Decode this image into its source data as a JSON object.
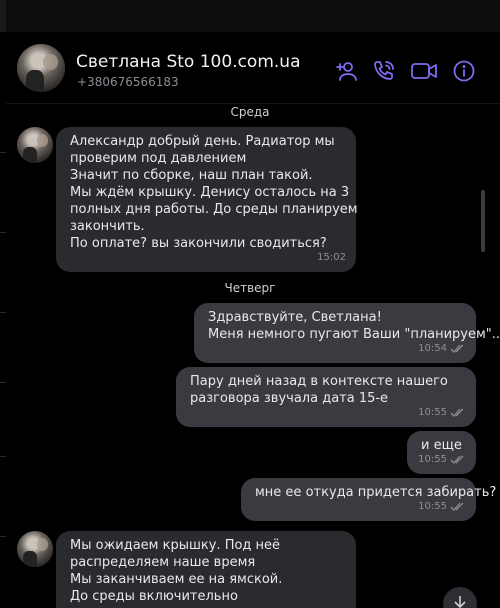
{
  "header": {
    "contact_name": "Светлана Sto 100.com.ua",
    "phone": "+380676566183",
    "icons": [
      "add-contact-icon",
      "phone-icon",
      "video-camera-icon",
      "info-icon"
    ],
    "accent_color": "#7f6bf0"
  },
  "days": {
    "wednesday": "Среда",
    "thursday": "Четверг"
  },
  "messages": [
    {
      "direction": "in",
      "lines": [
        "Александр добрый день. Радиатор мы",
        "проверим под давлением",
        "Значит по сборке, наш план такой.",
        "Мы ждём крышку.  Денису осталось на 3",
        "полных дня работы. До среды планируем",
        "закончить.",
        "По оплате? вы закончили сводиться?"
      ],
      "time": "15:02"
    },
    {
      "direction": "out",
      "lines": [
        "Здравствуйте, Светлана!",
        "Меня немного пугают Ваши \"планируем\".."
      ],
      "time": "10:54"
    },
    {
      "direction": "out",
      "lines": [
        "Пару дней назад в контексте нашего",
        "разговора звучала дата 15-е"
      ],
      "time": "10:55"
    },
    {
      "direction": "out",
      "lines": [
        "и еще"
      ],
      "time": "10:55"
    },
    {
      "direction": "out",
      "lines": [
        "мне ее откуда придется забирать?"
      ],
      "time": "10:55"
    },
    {
      "direction": "in",
      "lines": [
        "Мы ожидаем крышку. Под неё",
        "распределяем наше время",
        "Мы заканчиваем ее на ямской.",
        "До среды включительно"
      ],
      "time": ""
    }
  ]
}
